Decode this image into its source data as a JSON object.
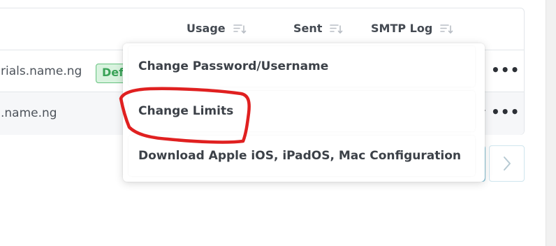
{
  "table": {
    "columns": {
      "usage": "Usage",
      "sent": "Sent",
      "smtp_log": "SMTP Log"
    },
    "rows": [
      {
        "email": "rials.name.ng",
        "badge": "Def"
      },
      {
        "email": ".name.ng"
      }
    ]
  },
  "dropdown": {
    "items": [
      {
        "label": "Change Password/Username"
      },
      {
        "label": "Change Limits"
      },
      {
        "label": "Download Apple iOS, iPadOS, Mac Configuration"
      }
    ]
  },
  "icons": {
    "sort": "sort-icon",
    "more": "more-horizontal-icon",
    "next": "chevron-right-icon",
    "caret": "caret-right-icon"
  },
  "colors": {
    "badge_bg": "#d9f3df",
    "badge_text": "#3aa358",
    "annotation_red": "#e02020",
    "pagination_active": "#8ec9dd"
  }
}
